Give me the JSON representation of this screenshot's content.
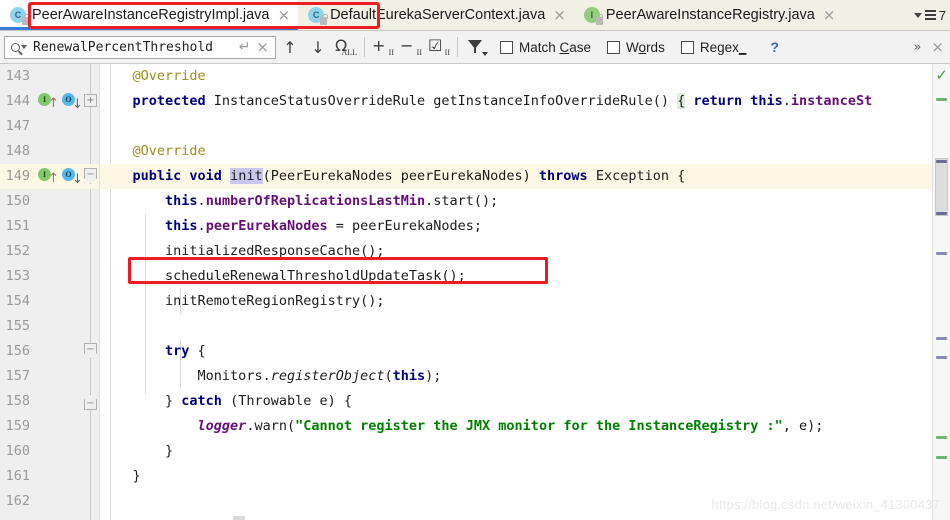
{
  "window": {
    "watermark": "https://blog.csdn.net/weixin_41300437"
  },
  "tabs": {
    "items": [
      {
        "label": "PeerAwareInstanceRegistryImpl.java",
        "icon": "java-class-icon",
        "active": true,
        "close": "×"
      },
      {
        "label": "DefaultEurekaServerContext.java",
        "icon": "java-class-icon",
        "active": false,
        "close": "×"
      },
      {
        "label": "PeerAwareInstanceRegistry.java",
        "icon": "java-interface-icon",
        "active": false,
        "close": "×"
      }
    ],
    "overflow_count": "7",
    "icon_letters": {
      "class": "C",
      "interface": "I"
    }
  },
  "find": {
    "query": "RenewalPercentThreshold",
    "placeholder": "Search",
    "return_icon": "↵",
    "clear_icon": "×",
    "prev_label": "↑",
    "next_label": "↓",
    "all_icon_letter": "Ω",
    "all_icon_sub": "ALL",
    "select_occurrence_sub": "II",
    "add_occurrence": "+",
    "remove_occurrence": "−",
    "select_all_occurrences": "☑",
    "options": [
      {
        "label_pre": "Match ",
        "mnemonic": "C",
        "label_post": "ase",
        "checked": false,
        "name": "match-case"
      },
      {
        "label_pre": "W",
        "mnemonic": "o",
        "label_post": "rds",
        "checked": false,
        "name": "words"
      },
      {
        "label_pre": "Regex",
        "mnemonic": "_",
        "label_post": "",
        "checked": false,
        "name": "regex"
      }
    ],
    "help": "?",
    "more": "»",
    "close": "×"
  },
  "editor": {
    "lines": [
      {
        "num": "143",
        "indent": 1,
        "highlight": false,
        "tokens": [
          {
            "t": "@Override",
            "c": "ann"
          }
        ]
      },
      {
        "num": "144",
        "indent": 1,
        "highlight": false,
        "gutter": [
          "implementing-method-icon",
          "overriding-method-icon"
        ],
        "fold": "plus",
        "tokens": [
          {
            "t": "protected ",
            "c": "kw"
          },
          {
            "t": "InstanceStatusOverrideRule getInstanceInfoOverrideRule() ",
            "c": "mth"
          },
          {
            "t": "{",
            "c": "brmatch"
          },
          {
            "t": " ",
            "c": "mth"
          },
          {
            "t": "return ",
            "c": "kw"
          },
          {
            "t": "this",
            "c": "kw"
          },
          {
            "t": ".",
            "c": "mth"
          },
          {
            "t": "instanceSt",
            "c": "fld"
          }
        ]
      },
      {
        "num": "147",
        "indent": 0,
        "highlight": false,
        "tokens": []
      },
      {
        "num": "148",
        "indent": 1,
        "highlight": false,
        "tokens": [
          {
            "t": "@Override",
            "c": "ann"
          }
        ]
      },
      {
        "num": "149",
        "indent": 1,
        "highlight": true,
        "gutter": [
          "implementing-method-icon",
          "overriding-method-icon"
        ],
        "fold": "minus-pent",
        "tokens": [
          {
            "t": "public void ",
            "c": "kw"
          },
          {
            "t": "init",
            "c": "sel"
          },
          {
            "t": "(PeerEurekaNodes peerEurekaNodes) ",
            "c": "mth"
          },
          {
            "t": "throws ",
            "c": "kw"
          },
          {
            "t": "Exception {",
            "c": "mth"
          }
        ]
      },
      {
        "num": "150",
        "indent": 2,
        "highlight": false,
        "tokens": [
          {
            "t": "this",
            "c": "kw"
          },
          {
            "t": ".",
            "c": "mth"
          },
          {
            "t": "numberOfReplicationsLastMin",
            "c": "fld"
          },
          {
            "t": ".start();",
            "c": "mth"
          }
        ]
      },
      {
        "num": "151",
        "indent": 2,
        "highlight": false,
        "tokens": [
          {
            "t": "this",
            "c": "kw"
          },
          {
            "t": ".",
            "c": "mth"
          },
          {
            "t": "peerEurekaNodes",
            "c": "fld"
          },
          {
            "t": " = peerEurekaNodes;",
            "c": "mth"
          }
        ]
      },
      {
        "num": "152",
        "indent": 2,
        "highlight": false,
        "tokens": [
          {
            "t": "initializedResponseCache();",
            "c": "mth"
          }
        ]
      },
      {
        "num": "153",
        "indent": 2,
        "highlight": false,
        "annotated": true,
        "tokens": [
          {
            "t": "scheduleRenewalThresholdUpdateTask();",
            "c": "mth"
          }
        ]
      },
      {
        "num": "154",
        "indent": 2,
        "highlight": false,
        "tokens": [
          {
            "t": "initRemoteRegionRegistry();",
            "c": "mth"
          }
        ]
      },
      {
        "num": "155",
        "indent": 0,
        "highlight": false,
        "tokens": []
      },
      {
        "num": "156",
        "indent": 2,
        "highlight": false,
        "fold": "minus-pent",
        "tokens": [
          {
            "t": "try ",
            "c": "kw"
          },
          {
            "t": "{",
            "c": "mth"
          }
        ]
      },
      {
        "num": "157",
        "indent": 3,
        "highlight": false,
        "tokens": [
          {
            "t": "Monitors.",
            "c": "mth"
          },
          {
            "t": "registerObject",
            "c": "ital"
          },
          {
            "t": "(",
            "c": "mth"
          },
          {
            "t": "this",
            "c": "kw"
          },
          {
            "t": ");",
            "c": "mth"
          }
        ]
      },
      {
        "num": "158",
        "indent": 2,
        "highlight": false,
        "fold": "minus-pent-up",
        "tokens": [
          {
            "t": "} ",
            "c": "mth"
          },
          {
            "t": "catch ",
            "c": "kw"
          },
          {
            "t": "(Throwable e) {",
            "c": "mth"
          }
        ]
      },
      {
        "num": "159",
        "indent": 3,
        "highlight": false,
        "tokens": [
          {
            "t": "logger",
            "c": "sfld"
          },
          {
            "t": ".warn(",
            "c": "mth"
          },
          {
            "t": "\"Cannot register the JMX monitor for the InstanceRegistry :\"",
            "c": "str"
          },
          {
            "t": ", e);",
            "c": "mth"
          }
        ]
      },
      {
        "num": "160",
        "indent": 2,
        "highlight": false,
        "tokens": [
          {
            "t": "}",
            "c": "mth"
          }
        ]
      },
      {
        "num": "161",
        "indent": 1,
        "highlight": false,
        "tokens": [
          {
            "t": "}",
            "c": "mth"
          }
        ]
      },
      {
        "num": "162",
        "indent": 0,
        "highlight": false,
        "tokens": []
      }
    ],
    "status_check": "✓"
  },
  "colors": {
    "accent": "#3a7ad9",
    "annotation": "#ee1c25",
    "keyword": "#000080",
    "string": "#008000",
    "field": "#660e7a",
    "annotation_text": "#9b8d1e",
    "line_highlight": "#fdf8e3",
    "ok_green": "#3aa33a"
  }
}
